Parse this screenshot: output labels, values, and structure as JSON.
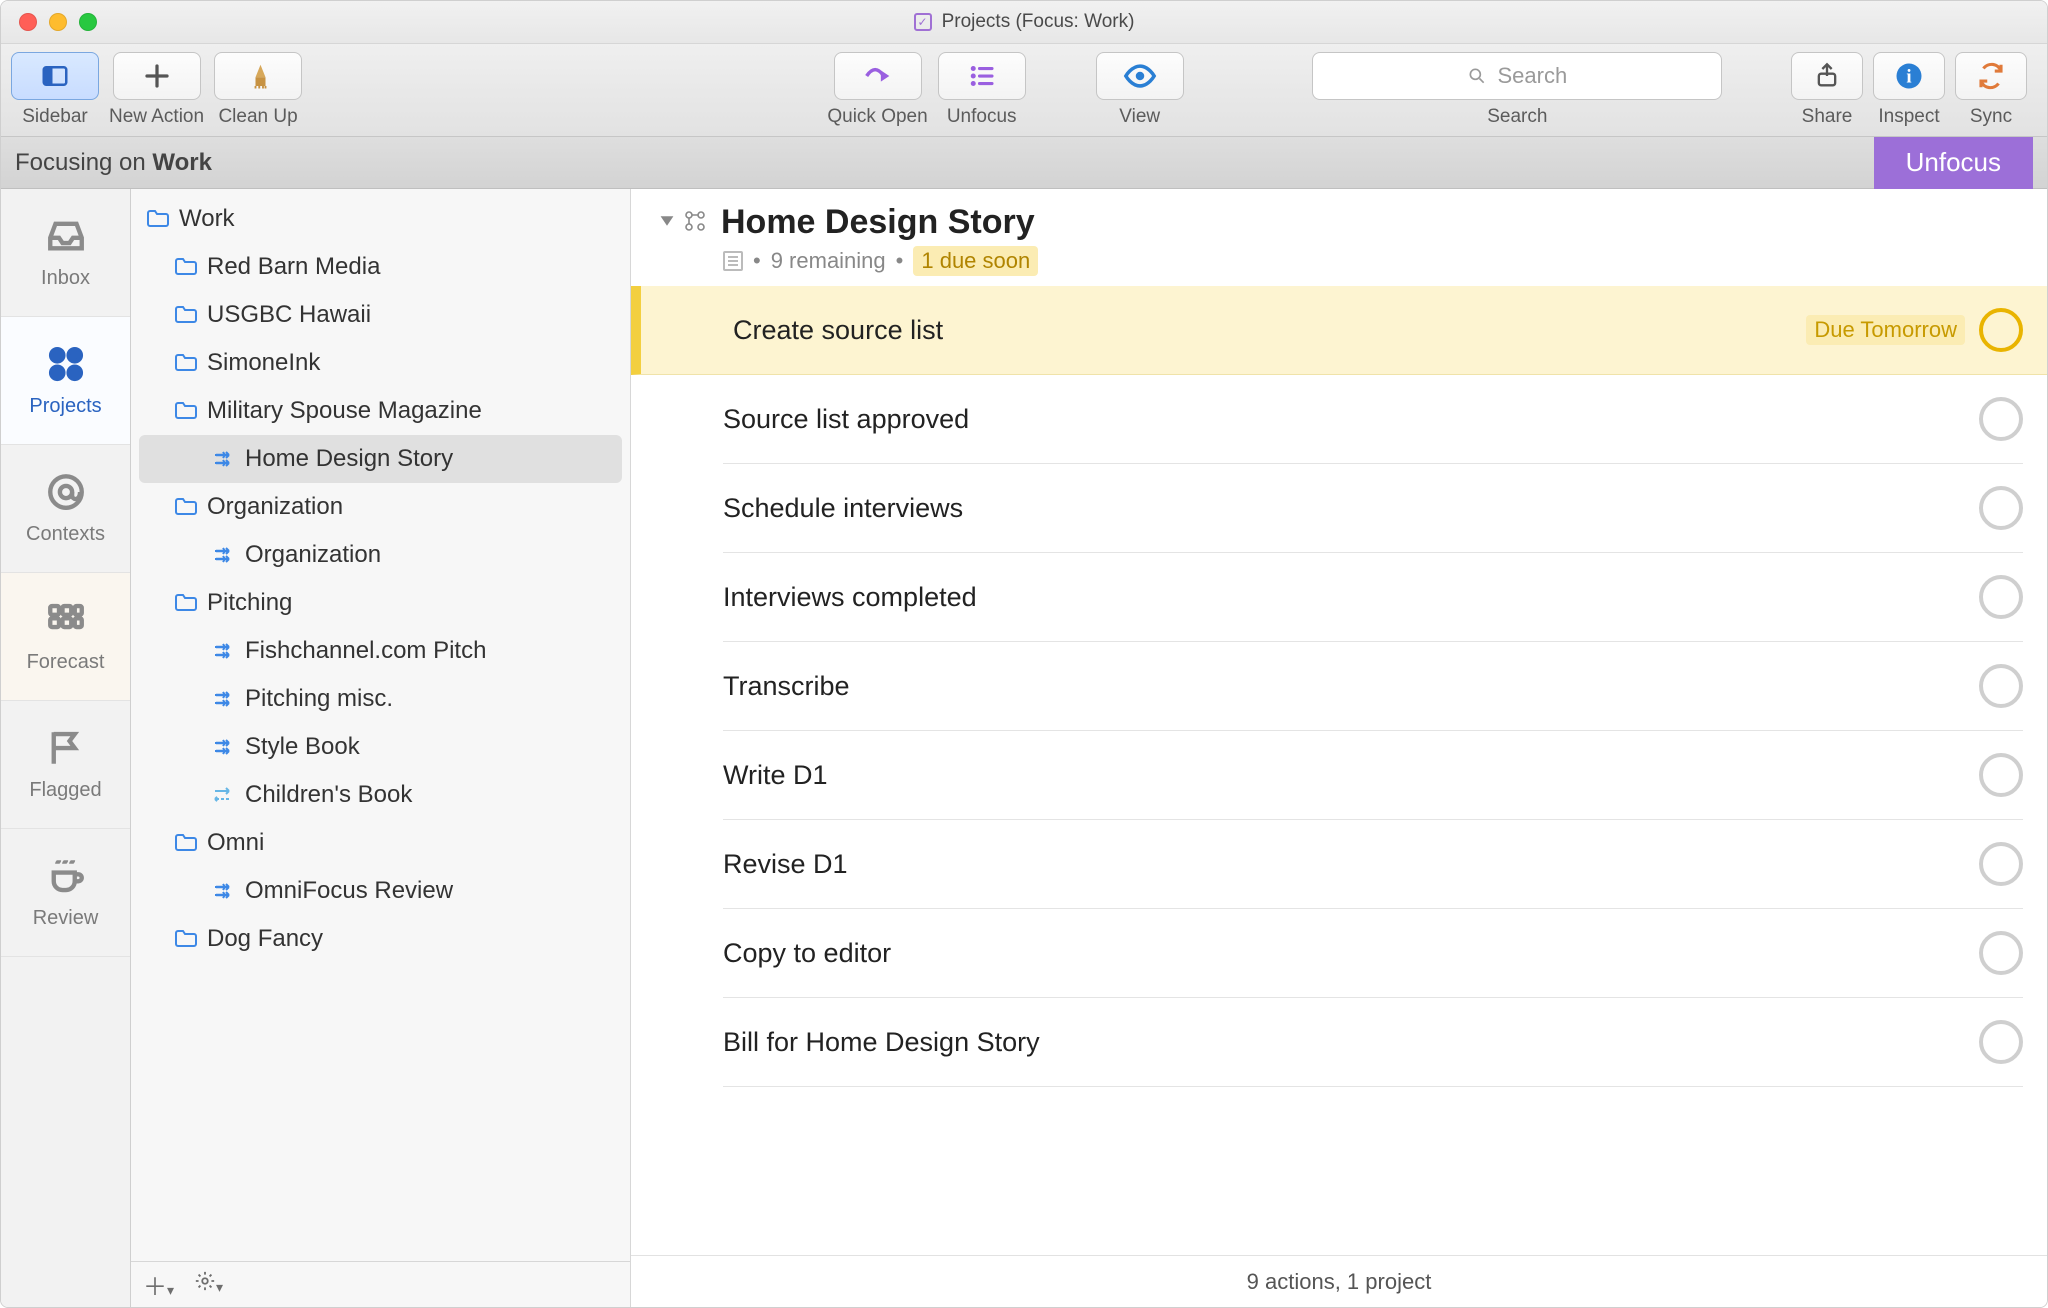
{
  "window": {
    "title": "Projects (Focus: Work)"
  },
  "toolbar": {
    "sidebar_label": "Sidebar",
    "newaction_label": "New Action",
    "cleanup_label": "Clean Up",
    "quickopen_label": "Quick Open",
    "unfocus_label": "Unfocus",
    "view_label": "View",
    "search_placeholder": "Search",
    "search_label": "Search",
    "share_label": "Share",
    "inspect_label": "Inspect",
    "sync_label": "Sync"
  },
  "focusbar": {
    "prefix": "Focusing on ",
    "target": "Work",
    "unfocus_button": "Unfocus"
  },
  "rail": {
    "items": [
      {
        "id": "inbox",
        "label": "Inbox"
      },
      {
        "id": "projects",
        "label": "Projects"
      },
      {
        "id": "contexts",
        "label": "Contexts"
      },
      {
        "id": "forecast",
        "label": "Forecast"
      },
      {
        "id": "flagged",
        "label": "Flagged"
      },
      {
        "id": "review",
        "label": "Review"
      }
    ]
  },
  "tree": {
    "items": [
      {
        "depth": 0,
        "kind": "folder",
        "label": "Work"
      },
      {
        "depth": 1,
        "kind": "folder",
        "label": "Red Barn Media"
      },
      {
        "depth": 1,
        "kind": "folder",
        "label": "USGBC Hawaii"
      },
      {
        "depth": 1,
        "kind": "folder",
        "label": "SimoneInk"
      },
      {
        "depth": 1,
        "kind": "folder",
        "label": "Military Spouse Magazine"
      },
      {
        "depth": 2,
        "kind": "project",
        "label": "Home Design Story",
        "selected": true
      },
      {
        "depth": 1,
        "kind": "folder",
        "label": "Organization"
      },
      {
        "depth": 2,
        "kind": "project",
        "label": "Organization"
      },
      {
        "depth": 1,
        "kind": "folder",
        "label": "Pitching"
      },
      {
        "depth": 2,
        "kind": "project",
        "label": "Fishchannel.com Pitch"
      },
      {
        "depth": 2,
        "kind": "project",
        "label": "Pitching misc."
      },
      {
        "depth": 2,
        "kind": "project",
        "label": "Style Book"
      },
      {
        "depth": 2,
        "kind": "single",
        "label": "Children's Book"
      },
      {
        "depth": 1,
        "kind": "folder",
        "label": "Omni"
      },
      {
        "depth": 2,
        "kind": "project",
        "label": "OmniFocus Review"
      },
      {
        "depth": 1,
        "kind": "folder",
        "label": "Dog Fancy"
      }
    ]
  },
  "content": {
    "title": "Home Design Story",
    "remaining_text": "9 remaining",
    "duesoon_text": "1 due soon",
    "tasks": [
      {
        "name": "Create source list",
        "due": "Due Tomorrow",
        "soon": true
      },
      {
        "name": "Source list approved"
      },
      {
        "name": "Schedule interviews"
      },
      {
        "name": "Interviews completed"
      },
      {
        "name": "Transcribe"
      },
      {
        "name": "Write D1"
      },
      {
        "name": "Revise D1"
      },
      {
        "name": "Copy to editor"
      },
      {
        "name": "Bill for Home Design Story"
      }
    ],
    "footer": "9 actions, 1 project"
  }
}
